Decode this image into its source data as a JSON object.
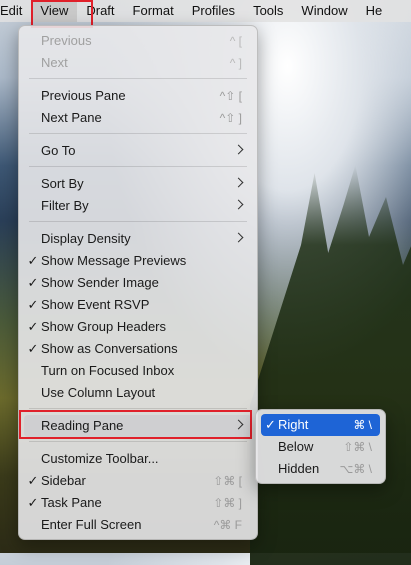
{
  "menubar": {
    "items": [
      "Edit",
      "View",
      "Draft",
      "Format",
      "Profiles",
      "Tools",
      "Window",
      "He"
    ],
    "active_index": 1
  },
  "view_menu": {
    "items": [
      {
        "label": "Previous",
        "shortcut": "^ [",
        "checked": false,
        "disabled": true
      },
      {
        "label": "Next",
        "shortcut": "^ ]",
        "checked": false,
        "disabled": true
      },
      {
        "label": "Previous Pane",
        "shortcut": "^⇧ [",
        "checked": false,
        "disabled": false
      },
      {
        "label": "Next Pane",
        "shortcut": "^⇧ ]",
        "checked": false,
        "disabled": false
      },
      {
        "label": "Go To",
        "submenu": true
      },
      {
        "label": "Sort By",
        "submenu": true
      },
      {
        "label": "Filter By",
        "submenu": true
      },
      {
        "label": "Display Density",
        "submenu": true
      },
      {
        "label": "Show Message Previews",
        "checked": true
      },
      {
        "label": "Show Sender Image",
        "checked": true
      },
      {
        "label": "Show Event RSVP",
        "checked": true
      },
      {
        "label": "Show Group Headers",
        "checked": true
      },
      {
        "label": "Show as Conversations",
        "checked": true
      },
      {
        "label": "Turn on Focused Inbox",
        "checked": false
      },
      {
        "label": "Use Column Layout",
        "checked": false
      },
      {
        "label": "Reading Pane",
        "submenu": true,
        "highlighted": true
      },
      {
        "label": "Customize Toolbar...",
        "checked": false
      },
      {
        "label": "Sidebar",
        "shortcut": "⇧⌘ [",
        "checked": true
      },
      {
        "label": "Task Pane",
        "shortcut": "⇧⌘ ]",
        "checked": true
      },
      {
        "label": "Enter Full Screen",
        "shortcut": "^⌘ F",
        "checked": false
      }
    ]
  },
  "reading_pane_submenu": {
    "items": [
      {
        "label": "Right",
        "shortcut": "⌘ \\",
        "checked": true,
        "selected": true
      },
      {
        "label": "Below",
        "shortcut": "⇧⌘ \\",
        "checked": false
      },
      {
        "label": "Hidden",
        "shortcut": "⌥⌘ \\",
        "checked": false
      }
    ]
  },
  "check_glyph": "✓",
  "colors": {
    "selection": "#1e64d6",
    "annotation_box": "#e0202a"
  }
}
